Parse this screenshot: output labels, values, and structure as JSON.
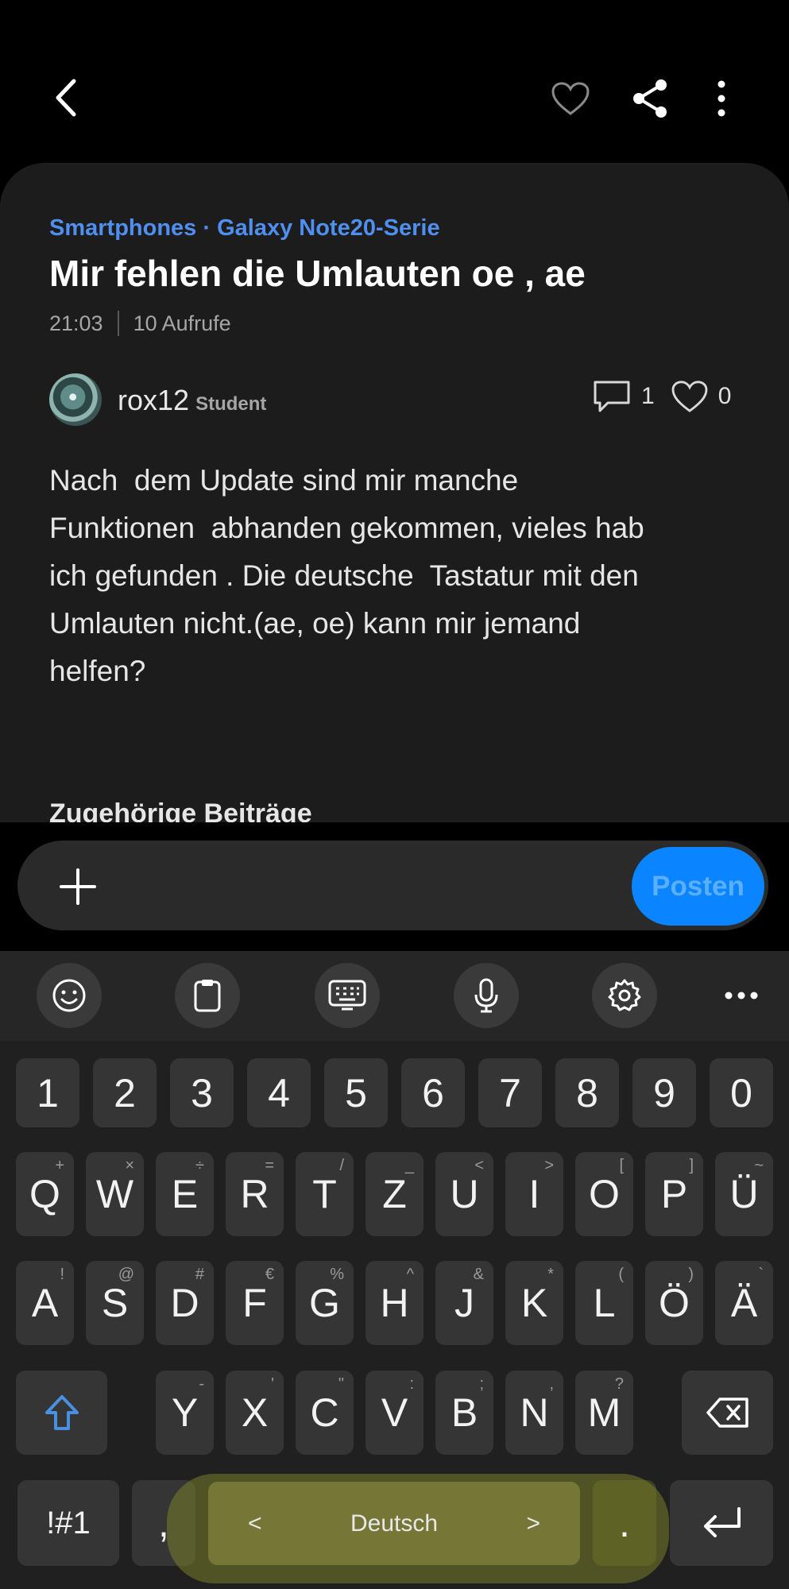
{
  "header": {
    "back_icon": "chevron-left-icon",
    "like_icon": "heart-outline-icon",
    "share_icon": "share-icon",
    "more_icon": "more-vertical-icon"
  },
  "post": {
    "breadcrumb": "Smartphones · Galaxy Note20-Serie",
    "title": "Mir fehlen die Umlauten oe , ae",
    "time": "21:03",
    "views": "10 Aufrufe",
    "author": "rox12",
    "author_role": "Student",
    "comments": "1",
    "likes": "0",
    "body": "Nach  dem Update sind mir manche\nFunktionen  abhanden gekommen, vieles hab\nich gefunden . Die deutsche  Tastatur mit den\nUmlauten nicht.(ae, oe) kann mir jemand\nhelfen?",
    "related_heading": "Zugehörige Beiträge"
  },
  "composer": {
    "add_icon": "plus-icon",
    "post_label": "Posten"
  },
  "keyboard": {
    "toolbar_icons": [
      "emoji-icon",
      "clipboard-icon",
      "keyboard-icon",
      "microphone-icon",
      "settings-icon",
      "more-horizontal-icon"
    ],
    "row_numbers": [
      "1",
      "2",
      "3",
      "4",
      "5",
      "6",
      "7",
      "8",
      "9",
      "0"
    ],
    "row1": [
      "Q",
      "W",
      "E",
      "R",
      "T",
      "Z",
      "U",
      "I",
      "O",
      "P",
      "Ü"
    ],
    "row1_sub": [
      "+",
      "×",
      "÷",
      "=",
      "/",
      "_",
      "<",
      ">",
      "[",
      "]",
      "~"
    ],
    "row2": [
      "A",
      "S",
      "D",
      "F",
      "G",
      "H",
      "J",
      "K",
      "L",
      "Ö",
      "Ä"
    ],
    "row2_sub": [
      "!",
      "@",
      "#",
      "€",
      "%",
      "^",
      "&",
      "*",
      "(",
      ")",
      "`"
    ],
    "row3": [
      "Y",
      "X",
      "C",
      "V",
      "B",
      "N",
      "M"
    ],
    "row3_sub": [
      "-",
      "'",
      "\"",
      ":",
      ";",
      ",",
      "?"
    ],
    "symbols_label": "!#1",
    "comma_label": ",",
    "language_label": "Deutsch",
    "lang_prev": "<",
    "lang_next": ">",
    "period_label": ".",
    "shift_color": "#4a90e2"
  }
}
